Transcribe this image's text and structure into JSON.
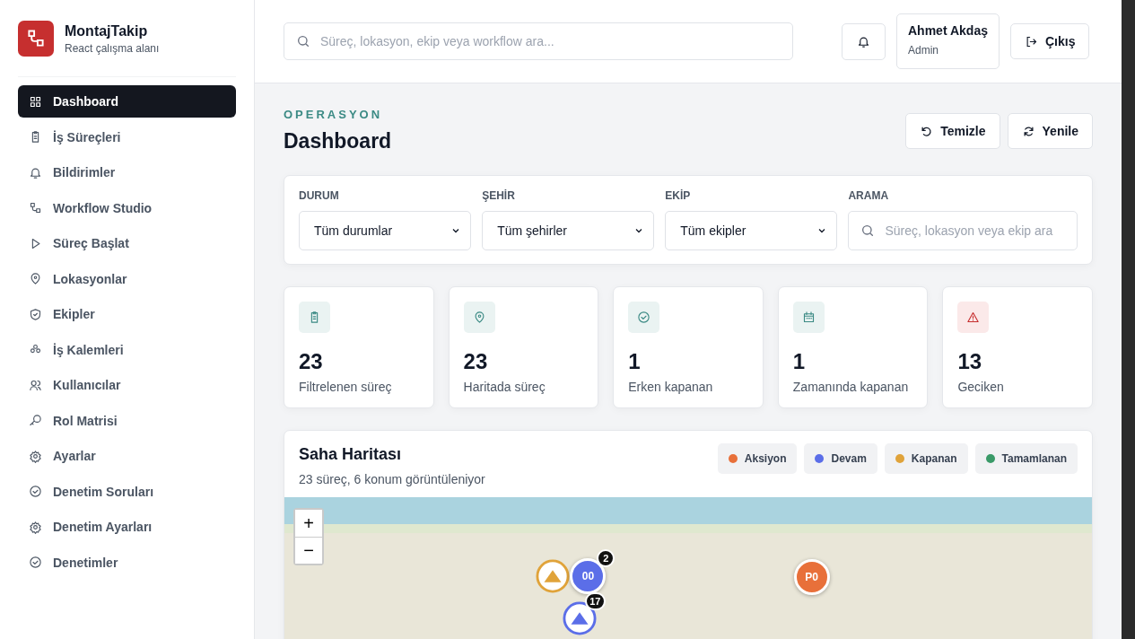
{
  "brand": {
    "name": "MontajTakip",
    "subtitle": "React çalışma alanı"
  },
  "sidebar": {
    "items": [
      {
        "label": "Dashboard",
        "selected": true
      },
      {
        "label": "İş Süreçleri",
        "selected": false
      },
      {
        "label": "Bildirimler",
        "selected": false
      },
      {
        "label": "Workflow Studio",
        "selected": false
      },
      {
        "label": "Süreç Başlat",
        "selected": false
      },
      {
        "label": "Lokasyonlar",
        "selected": false
      },
      {
        "label": "Ekipler",
        "selected": false
      },
      {
        "label": "İş Kalemleri",
        "selected": false
      },
      {
        "label": "Kullanıcılar",
        "selected": false
      },
      {
        "label": "Rol Matrisi",
        "selected": false
      },
      {
        "label": "Ayarlar",
        "selected": false
      },
      {
        "label": "Denetim Soruları",
        "selected": false
      },
      {
        "label": "Denetim Ayarları",
        "selected": false
      },
      {
        "label": "Denetimler",
        "selected": false
      }
    ]
  },
  "header": {
    "search": {
      "placeholder": "Süreç, lokasyon, ekip veya workflow ara..."
    },
    "user": {
      "name": "Ahmet Akdaş",
      "role": "Admin"
    },
    "logout": "Çıkış"
  },
  "page": {
    "eyebrow": "OPERASYON",
    "title": "Dashboard",
    "actions": [
      "Temizle",
      "Yenile"
    ]
  },
  "filters": [
    {
      "kind": "select",
      "label": "DURUM",
      "value": "Tüm durumlar"
    },
    {
      "kind": "select",
      "label": "ŞEHİR",
      "value": "Tüm şehirler"
    },
    {
      "kind": "select",
      "label": "EKİP",
      "value": "Tüm ekipler"
    },
    {
      "kind": "search",
      "label": "ARAMA",
      "placeholder": "Süreç, lokasyon veya ekip ara"
    }
  ],
  "stats": [
    {
      "kind": "normal",
      "value": "23",
      "label": "Filtrelenen süreç"
    },
    {
      "kind": "normal",
      "value": "23",
      "label": "Haritada süreç"
    },
    {
      "kind": "normal",
      "value": "1",
      "label": "Erken kapanan"
    },
    {
      "kind": "normal",
      "value": "1",
      "label": "Zamanında kapanan"
    },
    {
      "kind": "alert",
      "value": "13",
      "label": "Geciken"
    }
  ],
  "map": {
    "title": "Saha Haritası",
    "subtitle": "23 süreç, 6 konum görüntüleniyor",
    "legend": [
      {
        "label": "Aksiyon",
        "color": "#e8703a"
      },
      {
        "label": "Devam",
        "color": "#5b6ee8"
      },
      {
        "label": "Kapanan",
        "color": "#e0a33a"
      },
      {
        "label": "Tamamlanan",
        "color": "#3a9a68"
      }
    ],
    "zoom": [
      "+",
      "−"
    ],
    "markers": [
      {
        "kind": "logo",
        "color": "#e0a33a"
      },
      {
        "kind": "label",
        "label": "00",
        "count": "2",
        "color": "#5b6ee8"
      },
      {
        "kind": "logo",
        "count": "17",
        "color": "#5b6ee8"
      },
      {
        "kind": "label",
        "label": "P0",
        "color": "#e8703a"
      }
    ]
  }
}
